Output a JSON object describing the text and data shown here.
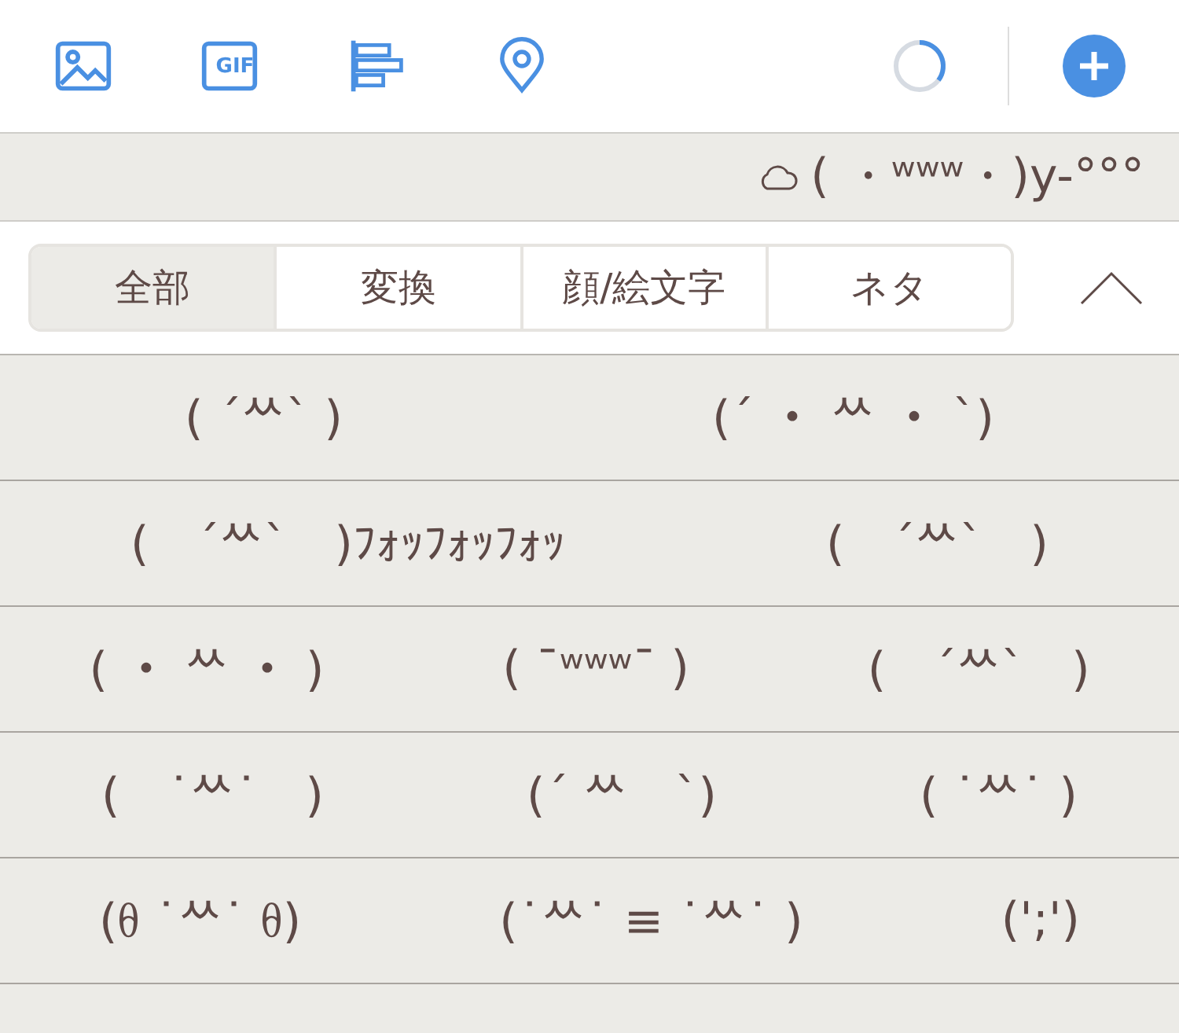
{
  "toolbar": {
    "loading": true,
    "gif_label": "GIF"
  },
  "suggestion": {
    "text": "( ・ʷʷʷ・)y-°°°"
  },
  "tabs": [
    {
      "label": "全部",
      "selected": true
    },
    {
      "label": "変換",
      "selected": false
    },
    {
      "label": "顔/絵文字",
      "selected": false
    },
    {
      "label": "ネタ",
      "selected": false
    }
  ],
  "rows": [
    [
      "( ´ᄊ` )",
      "(´ ・ ᄊ ・ `)"
    ],
    [
      "(　´ᄊ`　)ﾌｫｯﾌｫｯﾌｫｯ",
      "(　´ᄊ`　)"
    ],
    [
      "( ・ ᄊ ・ )",
      "( ¯ʷʷʷ¯ )",
      "(　´ᄊ`　)"
    ],
    [
      "(　˙ᄊ˙　)",
      "(´ ᄊ　`)",
      "( ˙ᄊ˙ )"
    ],
    [
      "(ᦲ ˙ᄊ˙ ᦲ)",
      "(˙ᄊ˙ ≡ ˙ᄊ˙ )",
      "(';')"
    ],
    []
  ]
}
